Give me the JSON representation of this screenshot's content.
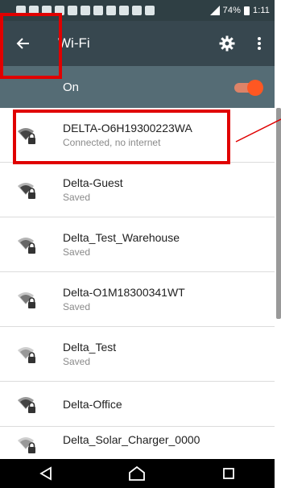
{
  "statusbar": {
    "battery_percent": "74%",
    "time": "1:11"
  },
  "appbar": {
    "title": "Wi-Fi",
    "back_icon": "back-arrow-icon",
    "settings_icon": "gear-icon",
    "more_icon": "more-vert-icon"
  },
  "toggle": {
    "label": "On",
    "state": "on"
  },
  "networks": [
    {
      "name": "DELTA-O6H19300223WA",
      "status": "Connected, no internet"
    },
    {
      "name": "Delta-Guest",
      "status": "Saved"
    },
    {
      "name": "Delta_Test_Warehouse",
      "status": "Saved"
    },
    {
      "name": "Delta-O1M18300341WT",
      "status": "Saved"
    },
    {
      "name": "Delta_Test",
      "status": "Saved"
    },
    {
      "name": "Delta-Office",
      "status": ""
    },
    {
      "name": "Delta_Solar_Charger_0000",
      "status": ""
    }
  ],
  "colors": {
    "annotation": "#e00000",
    "appbar": "#37474f",
    "toggle_row": "#556c75",
    "toggle_accent": "#ff5722"
  },
  "navbar": {
    "back": "nav-back-icon",
    "home": "nav-home-icon",
    "recents": "nav-recents-icon"
  }
}
